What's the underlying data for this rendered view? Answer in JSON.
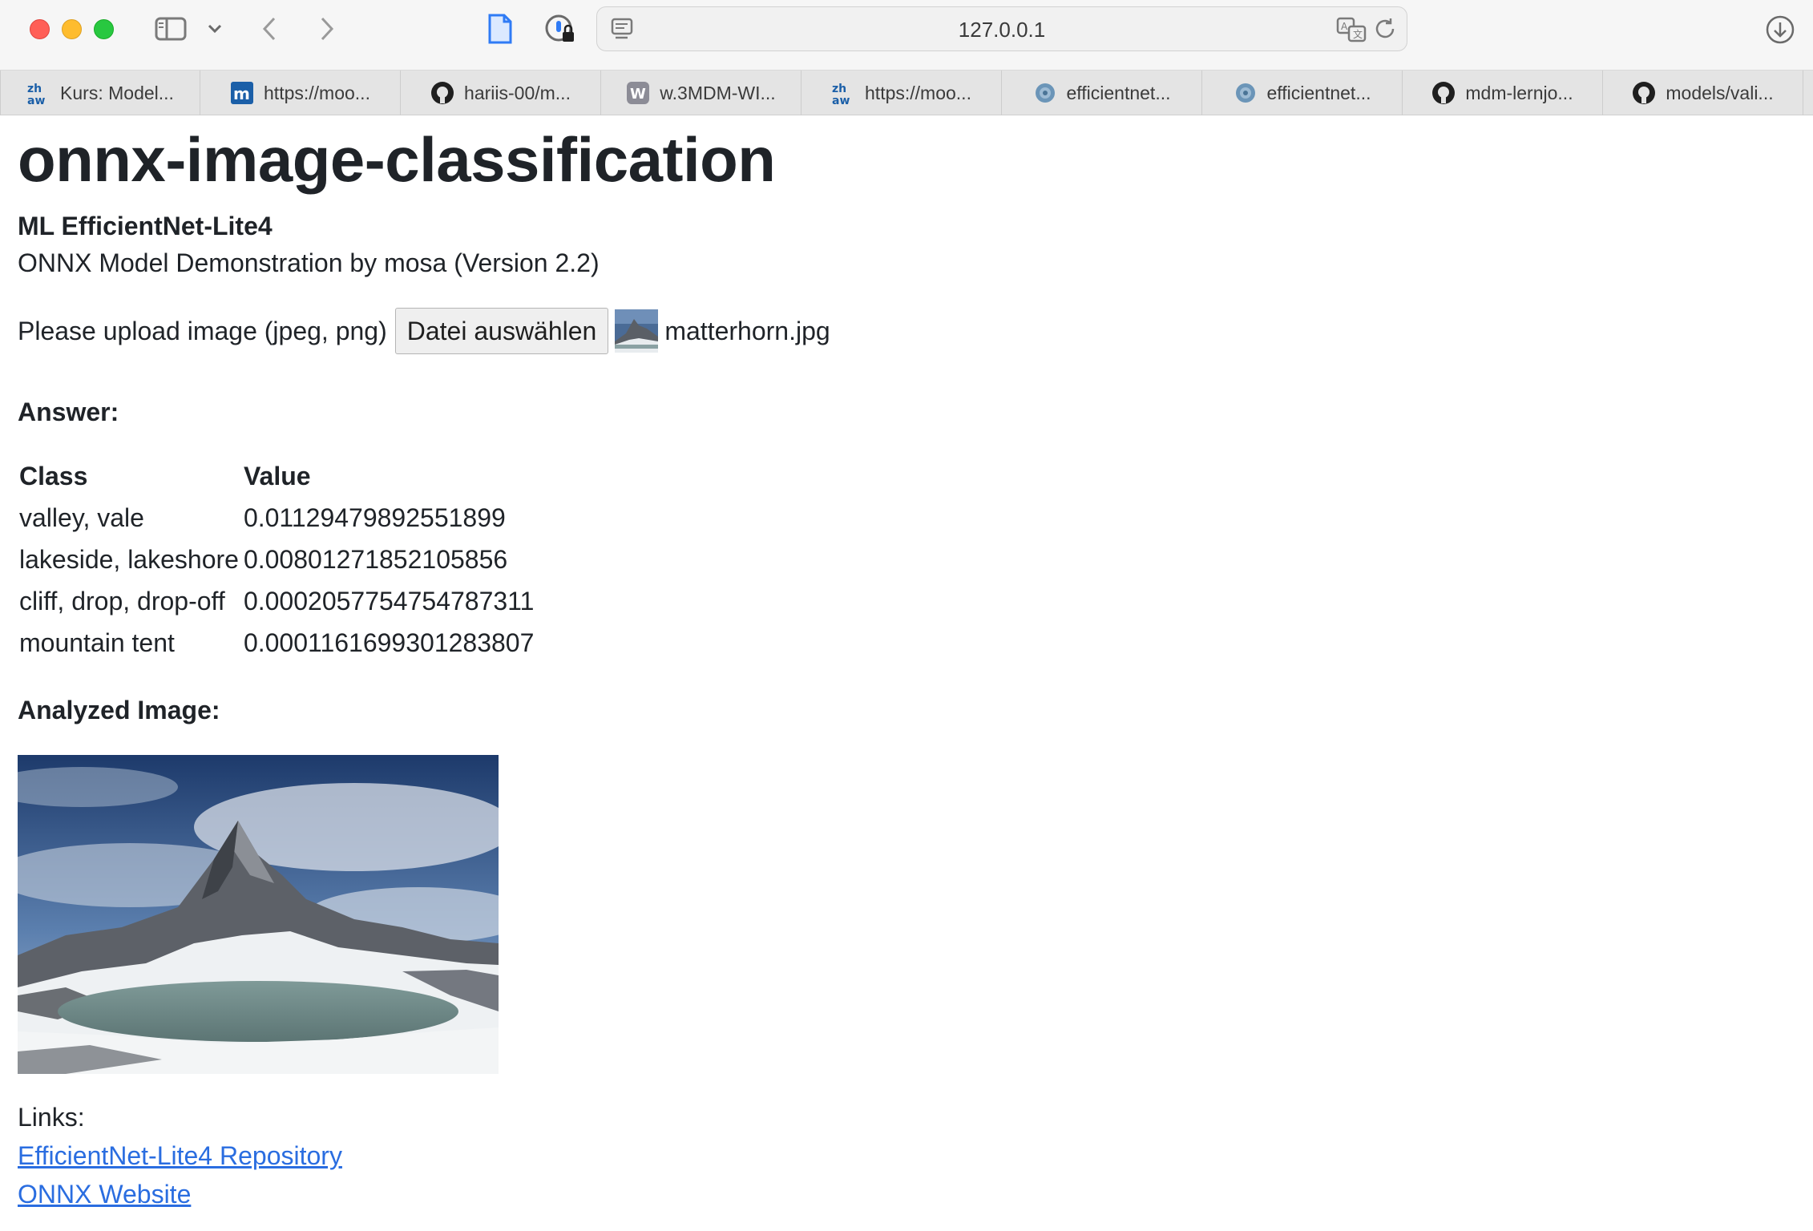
{
  "browser": {
    "url": "127.0.0.1",
    "icons": {
      "sidebar": "sidebar-icon",
      "back": "chevron-left-icon",
      "forward": "chevron-right-icon",
      "page": "document-icon",
      "password": "password-lock-icon",
      "reader": "reader-icon",
      "translate": "translate-icon",
      "reload": "reload-icon",
      "downloads": "download-icon"
    }
  },
  "tabs": [
    {
      "label": "Kurs: Model...",
      "favicon": "zhaw-icon"
    },
    {
      "label": "https://moo...",
      "favicon": "moodle-icon"
    },
    {
      "label": "hariis-00/m...",
      "favicon": "github-icon"
    },
    {
      "label": "w.3MDM-WI...",
      "favicon": "w-icon"
    },
    {
      "label": "https://moo...",
      "favicon": "zhaw-icon"
    },
    {
      "label": "efficientnet...",
      "favicon": "globe-icon"
    },
    {
      "label": "efficientnet...",
      "favicon": "globe-icon"
    },
    {
      "label": "mdm-lernjo...",
      "favicon": "github-icon"
    },
    {
      "label": "models/vali...",
      "favicon": "github-icon"
    }
  ],
  "page": {
    "title": "onnx-image-classification",
    "model_name": "ML EfficientNet-Lite4",
    "subtitle": "ONNX Model Demonstration by mosa (Version 2.2)",
    "upload_label": "Please upload image (jpeg, png)",
    "file_button": "Datei auswählen",
    "file_name": "matterhorn.jpg",
    "answer_heading": "Answer:",
    "table": {
      "headers": [
        "Class",
        "Value"
      ],
      "rows": [
        [
          "valley, vale",
          "0.01129479892551899"
        ],
        [
          "lakeside, lakeshore",
          "0.00801271852105856"
        ],
        [
          "cliff, drop, drop-off",
          "0.0002057754754787311"
        ],
        [
          "mountain tent",
          "0.0001161699301283807"
        ]
      ]
    },
    "analyzed_heading": "Analyzed Image:",
    "links_label": "Links:",
    "links": [
      {
        "label": "EfficientNet-Lite4 Repository"
      },
      {
        "label": "ONNX Website"
      }
    ]
  },
  "colors": {
    "link": "#2a6de0",
    "text": "#1f2328"
  }
}
